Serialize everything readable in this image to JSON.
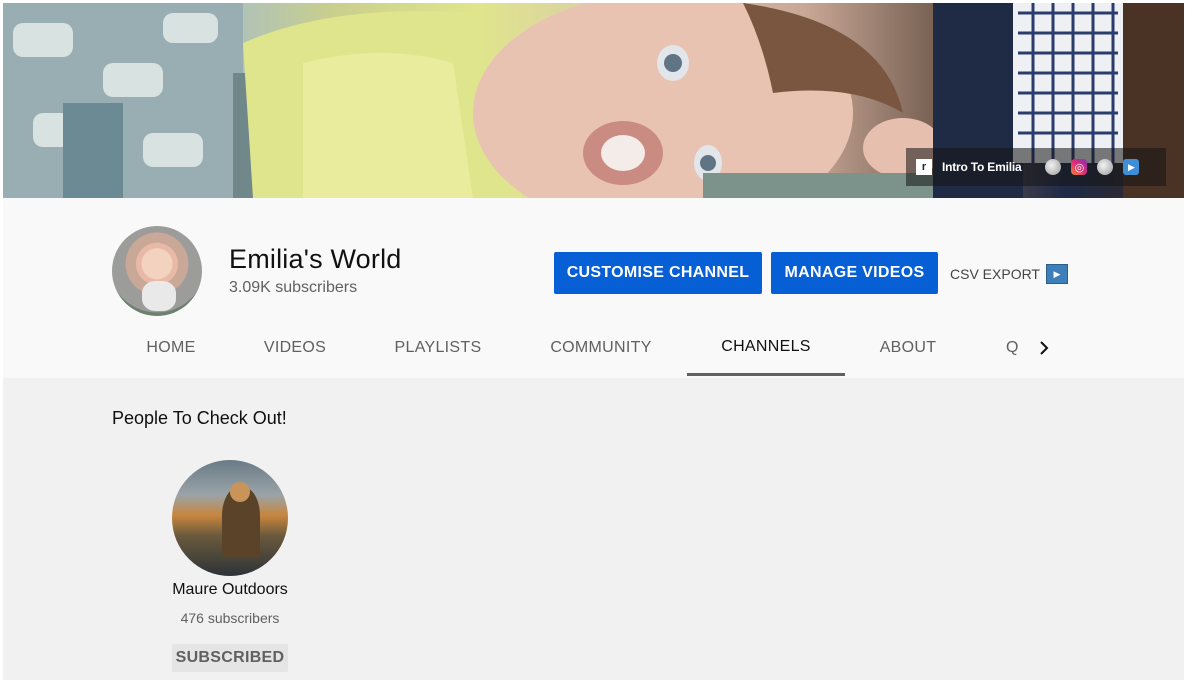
{
  "banner": {
    "links": [
      {
        "icon": "r-logo-icon",
        "label": "Intro To Emilia"
      },
      {
        "icon": "globe-icon"
      },
      {
        "icon": "instagram-icon"
      },
      {
        "icon": "globe-icon"
      },
      {
        "icon": "play-icon"
      }
    ]
  },
  "channel": {
    "name": "Emilia's World",
    "subscribers": "3.09K subscribers"
  },
  "actions": {
    "customise": "CUSTOMISE CHANNEL",
    "manage": "MANAGE VIDEOS",
    "csv_export": "CSV EXPORT"
  },
  "tabs": [
    {
      "label": "HOME"
    },
    {
      "label": "VIDEOS"
    },
    {
      "label": "PLAYLISTS"
    },
    {
      "label": "COMMUNITY"
    },
    {
      "label": "CHANNELS",
      "active": true
    },
    {
      "label": "ABOUT"
    }
  ],
  "content": {
    "section_title": "People To Check Out!",
    "channels": [
      {
        "name": "Maure Outdoors",
        "subscribers": "476 subscribers",
        "button": "SUBSCRIBED"
      }
    ]
  },
  "colors": {
    "accent": "#065fd4",
    "header_bg": "#f9f9f9",
    "content_bg": "#f1f1f1"
  }
}
